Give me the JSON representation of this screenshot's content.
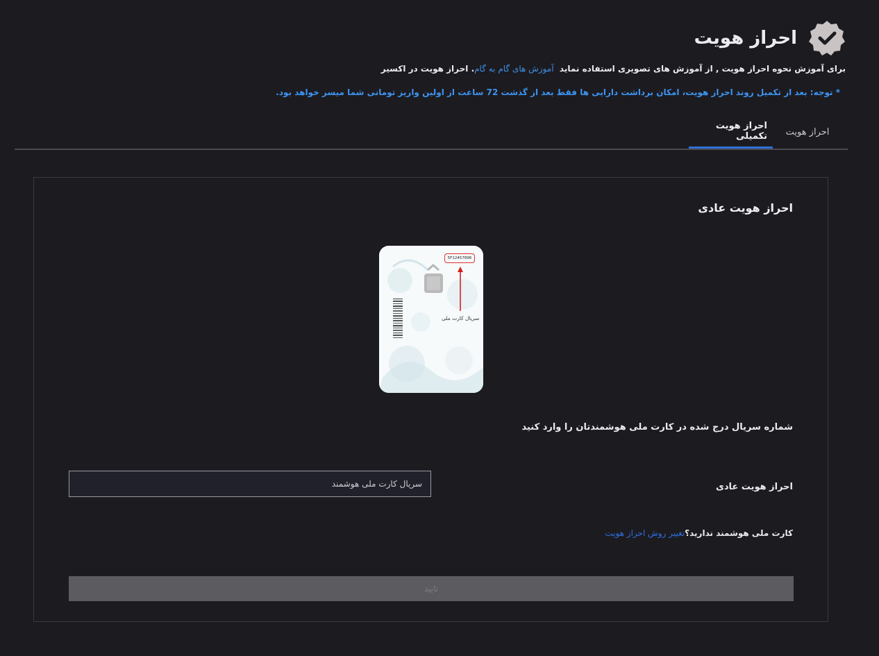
{
  "header": {
    "title": "احراز هویت",
    "badge_icon": "verified-check-badge-icon",
    "tutorial_text": "برای آموزش نحوه احراز هویت , از آموزش های تصویری استفاده نماید",
    "tutorial_link": "آموزش های گام به گام",
    "tutorial_suffix": "احراز هویت در اکسیر",
    "note": "* توجه: بعد از تکمیل روند احراز هویت، امکان برداشت دارایی ها فقط بعد از گذشت 72 ساعت از اولین واریز تومانی شما میسر خواهد بود."
  },
  "tabs": [
    {
      "label": "احراز هویت",
      "active": false
    },
    {
      "label": "احراز هویت تکمیلی",
      "active": true
    }
  ],
  "card": {
    "title": "احراز هویت عادی",
    "id_card_image": {
      "serial_sample": "5F12457896",
      "caption": "سریال کارت ملی"
    },
    "instruction": "شماره سریال درج شده در کارت ملی هوشمندتان را وارد کنید",
    "field_label": "احراز هویت عادی",
    "input_placeholder": "سریال کارت ملی هوشمند",
    "input_value": "",
    "no_card_text": "کارت ملی هوشمند ندارید؟",
    "change_method_link": "تغییر روش احراز هویت",
    "confirm_button": "تایید"
  },
  "colors": {
    "background": "#1c1b20",
    "link": "#3f8fe6",
    "note": "#3d94f0",
    "active_tab_underline": "#2e6fd6",
    "disabled_button": "#5c5c60"
  }
}
